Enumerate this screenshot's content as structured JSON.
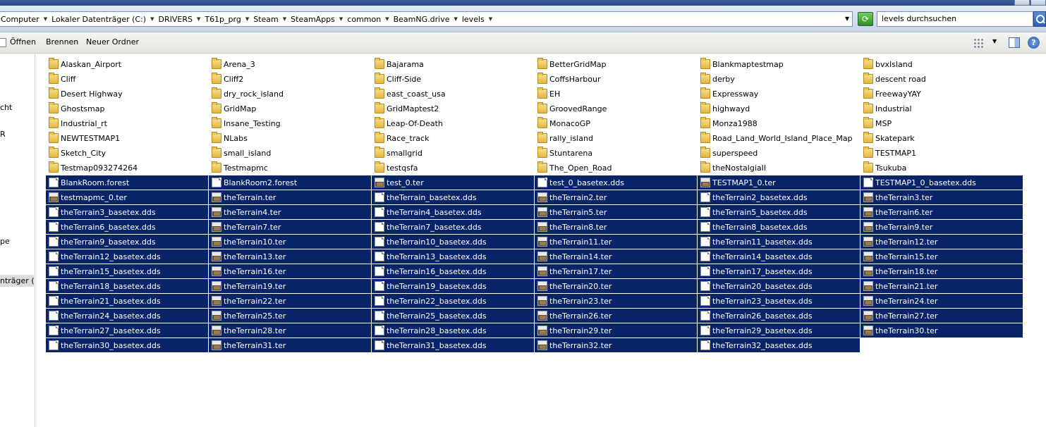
{
  "address": {
    "crumbs": [
      "Computer",
      "Lokaler Datenträger (C:)",
      "DRIVERS",
      "T61p_prg",
      "Steam",
      "SteamApps",
      "common",
      "BeamNG.drive",
      "levels"
    ],
    "search_placeholder": "levels durchsuchen"
  },
  "toolbar": {
    "open_label": "Öffnen",
    "burn_label": "Brennen",
    "new_folder_label": "Neuer Ordner",
    "help_label": "?"
  },
  "nav": {
    "items": [
      "cht",
      "R",
      "pe",
      "nträger (C"
    ]
  },
  "colors": {
    "selection": "#0a246a",
    "folder": "#e2b640"
  },
  "columns": [
    {
      "items": [
        {
          "name": "Alaskan_Airport",
          "type": "folder"
        },
        {
          "name": "Cliff",
          "type": "folder"
        },
        {
          "name": "Desert Highway",
          "type": "folder"
        },
        {
          "name": "Ghostsmap",
          "type": "folder"
        },
        {
          "name": "Industrial_rt",
          "type": "folder"
        },
        {
          "name": "NEWTESTMAP1",
          "type": "folder"
        },
        {
          "name": "Sketch_City",
          "type": "folder"
        },
        {
          "name": "Testmap093274264",
          "type": "folder"
        },
        {
          "name": "BlankRoom.forest",
          "type": "doc"
        },
        {
          "name": "testmapmc_0.ter",
          "type": "ter"
        },
        {
          "name": "theTerrain3_basetex.dds",
          "type": "doc"
        },
        {
          "name": "theTerrain6_basetex.dds",
          "type": "doc"
        },
        {
          "name": "theTerrain9_basetex.dds",
          "type": "doc"
        },
        {
          "name": "theTerrain12_basetex.dds",
          "type": "doc"
        },
        {
          "name": "theTerrain15_basetex.dds",
          "type": "doc"
        },
        {
          "name": "theTerrain18_basetex.dds",
          "type": "doc"
        },
        {
          "name": "theTerrain21_basetex.dds",
          "type": "doc"
        },
        {
          "name": "theTerrain24_basetex.dds",
          "type": "doc"
        },
        {
          "name": "theTerrain27_basetex.dds",
          "type": "doc"
        },
        {
          "name": "theTerrain30_basetex.dds",
          "type": "doc"
        }
      ]
    },
    {
      "items": [
        {
          "name": "Arena_3",
          "type": "folder"
        },
        {
          "name": "Cliff2",
          "type": "folder"
        },
        {
          "name": "dry_rock_island",
          "type": "folder"
        },
        {
          "name": "GridMap",
          "type": "folder"
        },
        {
          "name": "Insane_Testing",
          "type": "folder"
        },
        {
          "name": "NLabs",
          "type": "folder"
        },
        {
          "name": "small_island",
          "type": "folder"
        },
        {
          "name": "Testmapmc",
          "type": "folder"
        },
        {
          "name": "BlankRoom2.forest",
          "type": "doc"
        },
        {
          "name": "theTerrain.ter",
          "type": "ter"
        },
        {
          "name": "theTerrain4.ter",
          "type": "ter"
        },
        {
          "name": "theTerrain7.ter",
          "type": "ter"
        },
        {
          "name": "theTerrain10.ter",
          "type": "ter"
        },
        {
          "name": "theTerrain13.ter",
          "type": "ter"
        },
        {
          "name": "theTerrain16.ter",
          "type": "ter"
        },
        {
          "name": "theTerrain19.ter",
          "type": "ter"
        },
        {
          "name": "theTerrain22.ter",
          "type": "ter"
        },
        {
          "name": "theTerrain25.ter",
          "type": "ter"
        },
        {
          "name": "theTerrain28.ter",
          "type": "ter"
        },
        {
          "name": "theTerrain31.ter",
          "type": "ter"
        }
      ]
    },
    {
      "items": [
        {
          "name": "Bajarama",
          "type": "folder"
        },
        {
          "name": "Cliff-Side",
          "type": "folder"
        },
        {
          "name": "east_coast_usa",
          "type": "folder"
        },
        {
          "name": "GridMaptest2",
          "type": "folder"
        },
        {
          "name": "Leap-Of-Death",
          "type": "folder"
        },
        {
          "name": "Race_track",
          "type": "folder"
        },
        {
          "name": "smallgrid",
          "type": "folder"
        },
        {
          "name": "testqsfa",
          "type": "folder"
        },
        {
          "name": "test_0.ter",
          "type": "ter"
        },
        {
          "name": "theTerrain_basetex.dds",
          "type": "doc"
        },
        {
          "name": "theTerrain4_basetex.dds",
          "type": "doc"
        },
        {
          "name": "theTerrain7_basetex.dds",
          "type": "doc"
        },
        {
          "name": "theTerrain10_basetex.dds",
          "type": "doc"
        },
        {
          "name": "theTerrain13_basetex.dds",
          "type": "doc"
        },
        {
          "name": "theTerrain16_basetex.dds",
          "type": "doc"
        },
        {
          "name": "theTerrain19_basetex.dds",
          "type": "doc"
        },
        {
          "name": "theTerrain22_basetex.dds",
          "type": "doc"
        },
        {
          "name": "theTerrain25_basetex.dds",
          "type": "doc"
        },
        {
          "name": "theTerrain28_basetex.dds",
          "type": "doc"
        },
        {
          "name": "theTerrain31_basetex.dds",
          "type": "doc"
        }
      ]
    },
    {
      "items": [
        {
          "name": "BetterGridMap",
          "type": "folder"
        },
        {
          "name": "CoffsHarbour",
          "type": "folder"
        },
        {
          "name": "EH",
          "type": "folder"
        },
        {
          "name": "GroovedRange",
          "type": "folder"
        },
        {
          "name": "MonacoGP",
          "type": "folder"
        },
        {
          "name": "rally_island",
          "type": "folder"
        },
        {
          "name": "Stuntarena",
          "type": "folder"
        },
        {
          "name": "The_Open_Road",
          "type": "folder"
        },
        {
          "name": "test_0_basetex.dds",
          "type": "doc"
        },
        {
          "name": "theTerrain2.ter",
          "type": "ter"
        },
        {
          "name": "theTerrain5.ter",
          "type": "ter"
        },
        {
          "name": "theTerrain8.ter",
          "type": "ter"
        },
        {
          "name": "theTerrain11.ter",
          "type": "ter"
        },
        {
          "name": "theTerrain14.ter",
          "type": "ter"
        },
        {
          "name": "theTerrain17.ter",
          "type": "ter"
        },
        {
          "name": "theTerrain20.ter",
          "type": "ter"
        },
        {
          "name": "theTerrain23.ter",
          "type": "ter"
        },
        {
          "name": "theTerrain26.ter",
          "type": "ter"
        },
        {
          "name": "theTerrain29.ter",
          "type": "ter"
        },
        {
          "name": "theTerrain32.ter",
          "type": "ter"
        }
      ]
    },
    {
      "items": [
        {
          "name": "Blankmaptestmap",
          "type": "folder"
        },
        {
          "name": "derby",
          "type": "folder"
        },
        {
          "name": "Expressway",
          "type": "folder"
        },
        {
          "name": "highwayd",
          "type": "folder"
        },
        {
          "name": "Monza1988",
          "type": "folder"
        },
        {
          "name": "Road_Land_World_Island_Place_Map",
          "type": "folder"
        },
        {
          "name": "superspeed",
          "type": "folder"
        },
        {
          "name": "theNostalgiaII",
          "type": "folder"
        },
        {
          "name": "TESTMAP1_0.ter",
          "type": "ter"
        },
        {
          "name": "theTerrain2_basetex.dds",
          "type": "doc"
        },
        {
          "name": "theTerrain5_basetex.dds",
          "type": "doc"
        },
        {
          "name": "theTerrain8_basetex.dds",
          "type": "doc"
        },
        {
          "name": "theTerrain11_basetex.dds",
          "type": "doc"
        },
        {
          "name": "theTerrain14_basetex.dds",
          "type": "doc"
        },
        {
          "name": "theTerrain17_basetex.dds",
          "type": "doc"
        },
        {
          "name": "theTerrain20_basetex.dds",
          "type": "doc"
        },
        {
          "name": "theTerrain23_basetex.dds",
          "type": "doc"
        },
        {
          "name": "theTerrain26_basetex.dds",
          "type": "doc"
        },
        {
          "name": "theTerrain29_basetex.dds",
          "type": "doc"
        },
        {
          "name": "theTerrain32_basetex.dds",
          "type": "doc"
        }
      ]
    },
    {
      "items": [
        {
          "name": "bvxIsland",
          "type": "folder"
        },
        {
          "name": "descent road",
          "type": "folder"
        },
        {
          "name": "FreewayYAY",
          "type": "folder"
        },
        {
          "name": "Industrial",
          "type": "folder"
        },
        {
          "name": "MSP",
          "type": "folder"
        },
        {
          "name": "Skatepark",
          "type": "folder"
        },
        {
          "name": "TESTMAP1",
          "type": "folder"
        },
        {
          "name": "Tsukuba",
          "type": "folder"
        },
        {
          "name": "TESTMAP1_0_basetex.dds",
          "type": "doc"
        },
        {
          "name": "theTerrain3.ter",
          "type": "ter"
        },
        {
          "name": "theTerrain6.ter",
          "type": "ter"
        },
        {
          "name": "theTerrain9.ter",
          "type": "ter"
        },
        {
          "name": "theTerrain12.ter",
          "type": "ter"
        },
        {
          "name": "theTerrain15.ter",
          "type": "ter"
        },
        {
          "name": "theTerrain18.ter",
          "type": "ter"
        },
        {
          "name": "theTerrain21.ter",
          "type": "ter"
        },
        {
          "name": "theTerrain24.ter",
          "type": "ter"
        },
        {
          "name": "theTerrain27.ter",
          "type": "ter"
        },
        {
          "name": "theTerrain30.ter",
          "type": "ter"
        }
      ]
    }
  ]
}
